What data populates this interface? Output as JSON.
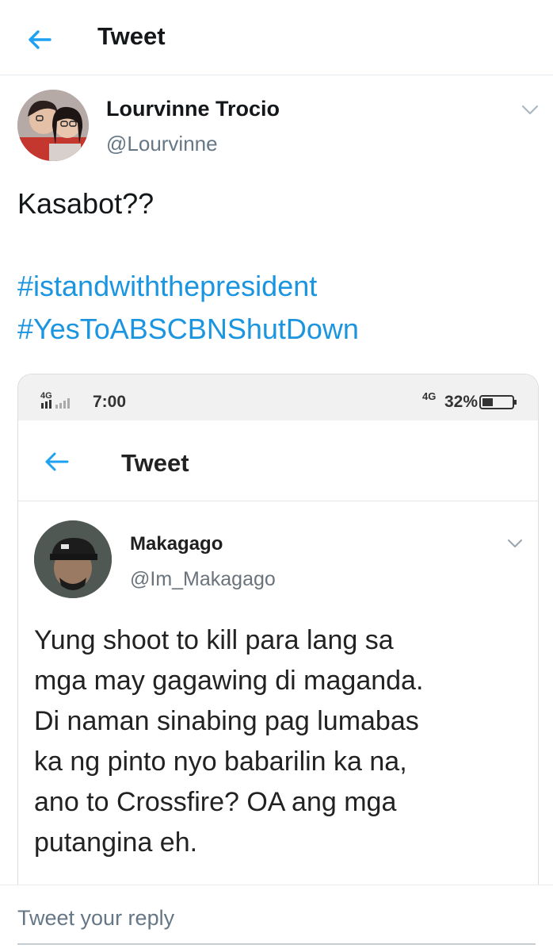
{
  "header": {
    "title": "Tweet",
    "back_icon": "arrow-left-icon",
    "accent": "#1da1f2"
  },
  "tweet": {
    "author_name": "Lourvinne Trocio",
    "author_handle": "@Lourvinne",
    "text": "Kasabot??",
    "hashtags": [
      "#istandwiththepresident",
      "#YesToABSCBNShutDown"
    ],
    "hashtag_color": "#1b95e0",
    "menu_icon": "chevron-down-icon"
  },
  "embedded_screenshot": {
    "status_bar": {
      "network": "4G",
      "time": "7:00",
      "battery": "32%"
    },
    "header": {
      "title": "Tweet"
    },
    "tweet": {
      "author_name": "Makagago",
      "author_handle": "@Im_Makagago",
      "text_lines": [
        "Yung shoot to kill para lang sa",
        "mga may gagawing di maganda.",
        "Di naman sinabing pag lumabas",
        "ka ng pinto nyo babarilin ka na,",
        "ano to Crossfire? OA ang mga",
        "putangina eh."
      ]
    }
  },
  "reply": {
    "placeholder": "Tweet your reply"
  }
}
